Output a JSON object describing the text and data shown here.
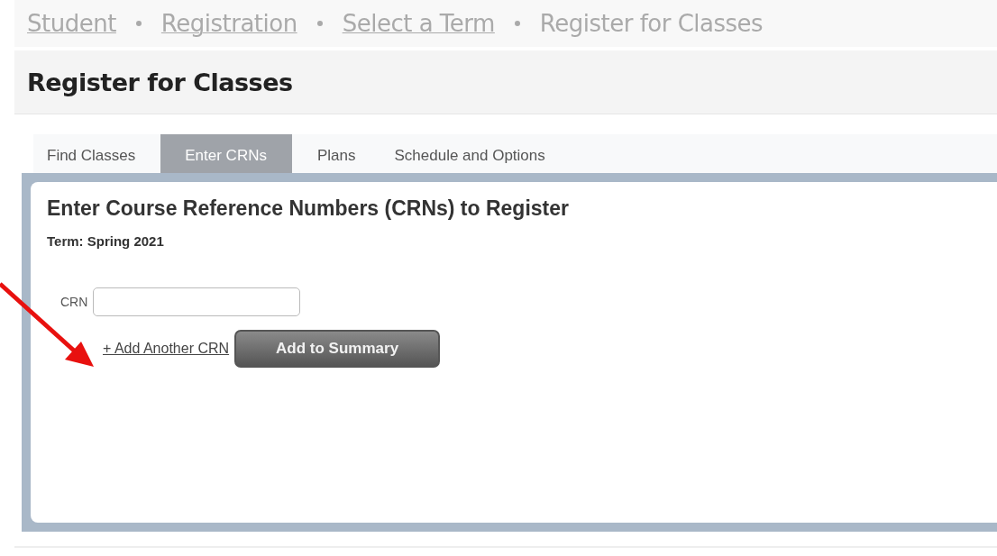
{
  "breadcrumbs": [
    {
      "label": "Student",
      "kind": "link"
    },
    {
      "label": "Registration",
      "kind": "link"
    },
    {
      "label": "Select a Term",
      "kind": "link"
    },
    {
      "label": "Register for Classes",
      "kind": "current"
    }
  ],
  "page_title": "Register for Classes",
  "tabs": [
    {
      "label": "Find Classes",
      "selected": false
    },
    {
      "label": "Enter CRNs",
      "selected": true
    },
    {
      "label": "Plans",
      "selected": false
    },
    {
      "label": "Schedule and Options",
      "selected": false
    }
  ],
  "panel": {
    "heading": "Enter Course Reference Numbers (CRNs) to Register",
    "term": "Term: Spring 2021",
    "crn_label": "CRN",
    "add_link": "+ Add Another CRN",
    "submit": "Add to Summary"
  }
}
